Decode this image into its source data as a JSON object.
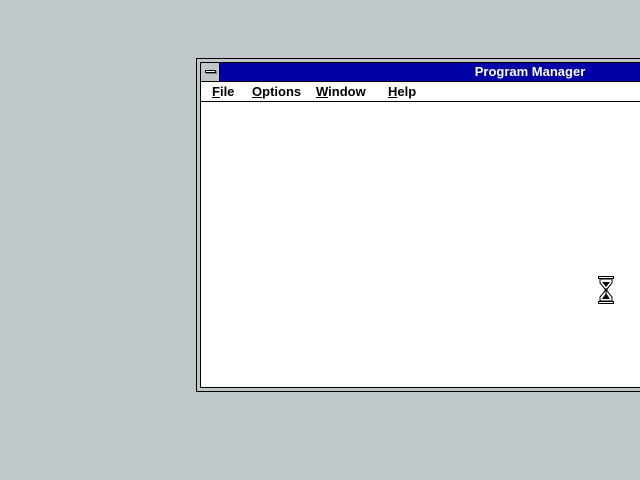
{
  "window": {
    "title": "Program Manager"
  },
  "menubar": {
    "items": [
      {
        "accel": "F",
        "rest": "ile"
      },
      {
        "accel": "O",
        "rest": "ptions"
      },
      {
        "accel": "W",
        "rest": "indow"
      },
      {
        "accel": "H",
        "rest": "elp"
      }
    ]
  },
  "icons": {
    "system_menu": "system-menu-icon",
    "cursor": "hourglass-cursor-icon"
  },
  "colors": {
    "desktop": "#c0c7c8",
    "titlebar_active": "#0000a8",
    "client": "#ffffff"
  }
}
